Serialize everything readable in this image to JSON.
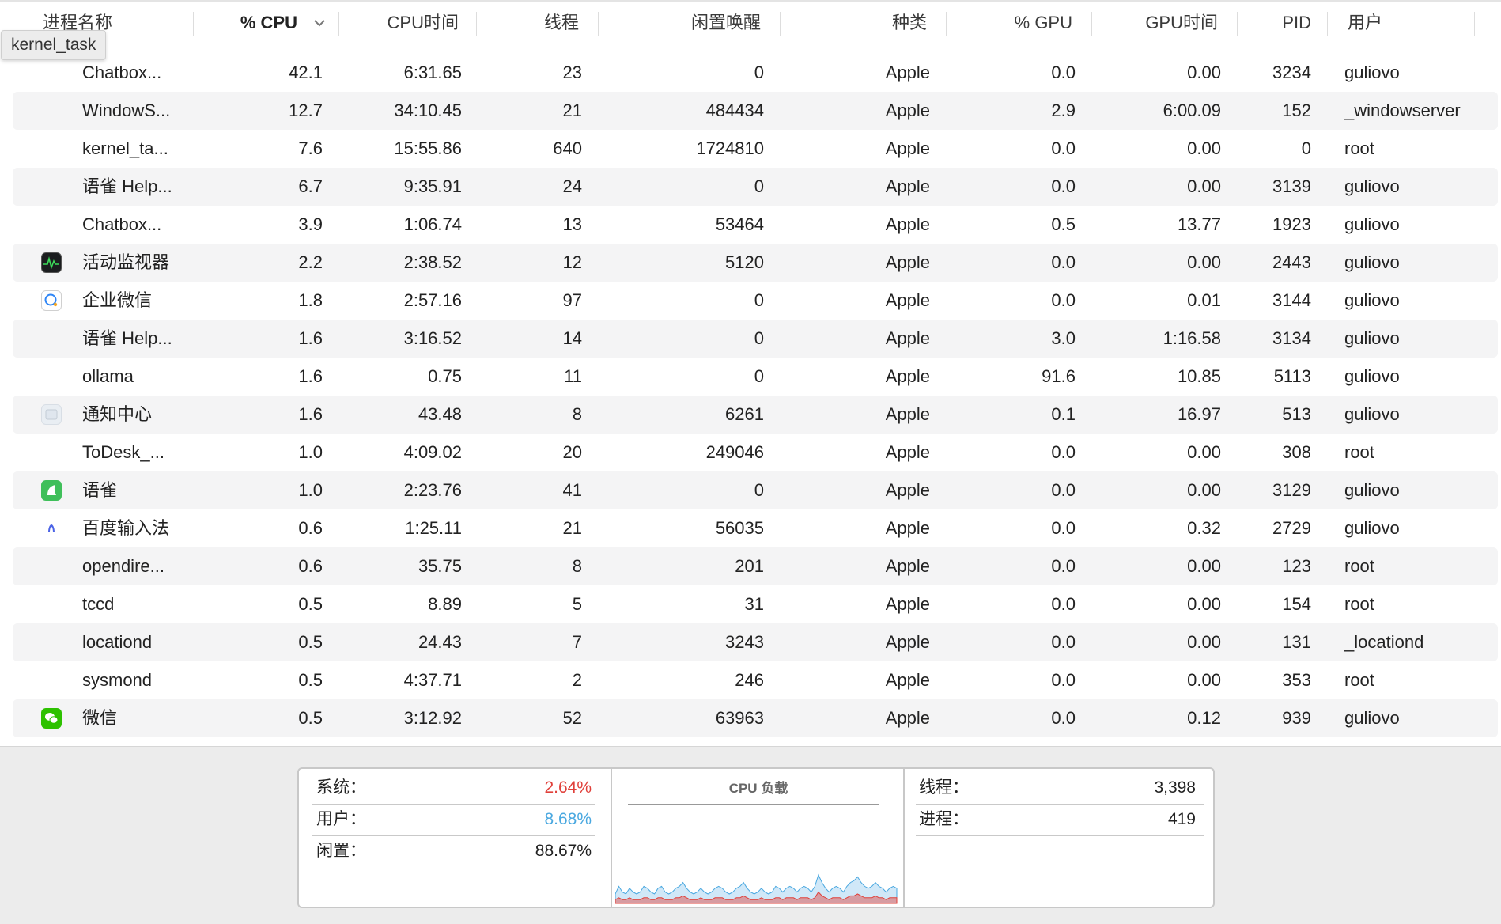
{
  "tooltip": "kernel_task",
  "headers": {
    "name": "进程名称",
    "cpu": "% CPU",
    "cpu_time": "CPU时间",
    "threads": "线程",
    "idle_wake": "闲置唤醒",
    "kind": "种类",
    "gpu": "% GPU",
    "gpu_time": "GPU时间",
    "pid": "PID",
    "user": "用户"
  },
  "sort_indicator": "chevron-down-icon",
  "processes": [
    {
      "icon": "",
      "name": "Chatbox...",
      "cpu": "42.1",
      "cpu_time": "6:31.65",
      "threads": "23",
      "idle_wake": "0",
      "kind": "Apple",
      "gpu": "0.0",
      "gpu_time": "0.00",
      "pid": "3234",
      "user": "guliovo"
    },
    {
      "icon": "",
      "name": "WindowS...",
      "cpu": "12.7",
      "cpu_time": "34:10.45",
      "threads": "21",
      "idle_wake": "484434",
      "kind": "Apple",
      "gpu": "2.9",
      "gpu_time": "6:00.09",
      "pid": "152",
      "user": "_windowserver"
    },
    {
      "icon": "",
      "name": "kernel_ta...",
      "cpu": "7.6",
      "cpu_time": "15:55.86",
      "threads": "640",
      "idle_wake": "1724810",
      "kind": "Apple",
      "gpu": "0.0",
      "gpu_time": "0.00",
      "pid": "0",
      "user": "root"
    },
    {
      "icon": "",
      "name": "语雀 Help...",
      "cpu": "6.7",
      "cpu_time": "9:35.91",
      "threads": "24",
      "idle_wake": "0",
      "kind": "Apple",
      "gpu": "0.0",
      "gpu_time": "0.00",
      "pid": "3139",
      "user": "guliovo"
    },
    {
      "icon": "",
      "name": "Chatbox...",
      "cpu": "3.9",
      "cpu_time": "1:06.74",
      "threads": "13",
      "idle_wake": "53464",
      "kind": "Apple",
      "gpu": "0.5",
      "gpu_time": "13.77",
      "pid": "1923",
      "user": "guliovo"
    },
    {
      "icon": "activity-monitor-icon",
      "name": "活动监视器",
      "cpu": "2.2",
      "cpu_time": "2:38.52",
      "threads": "12",
      "idle_wake": "5120",
      "kind": "Apple",
      "gpu": "0.0",
      "gpu_time": "0.00",
      "pid": "2443",
      "user": "guliovo"
    },
    {
      "icon": "wecom-icon",
      "name": "企业微信",
      "cpu": "1.8",
      "cpu_time": "2:57.16",
      "threads": "97",
      "idle_wake": "0",
      "kind": "Apple",
      "gpu": "0.0",
      "gpu_time": "0.01",
      "pid": "3144",
      "user": "guliovo"
    },
    {
      "icon": "",
      "name": "语雀 Help...",
      "cpu": "1.6",
      "cpu_time": "3:16.52",
      "threads": "14",
      "idle_wake": "0",
      "kind": "Apple",
      "gpu": "3.0",
      "gpu_time": "1:16.58",
      "pid": "3134",
      "user": "guliovo"
    },
    {
      "icon": "",
      "name": "ollama",
      "cpu": "1.6",
      "cpu_time": "0.75",
      "threads": "11",
      "idle_wake": "0",
      "kind": "Apple",
      "gpu": "91.6",
      "gpu_time": "10.85",
      "pid": "5113",
      "user": "guliovo"
    },
    {
      "icon": "notification-center-icon",
      "name": "通知中心",
      "cpu": "1.6",
      "cpu_time": "43.48",
      "threads": "8",
      "idle_wake": "6261",
      "kind": "Apple",
      "gpu": "0.1",
      "gpu_time": "16.97",
      "pid": "513",
      "user": "guliovo"
    },
    {
      "icon": "",
      "name": "ToDesk_...",
      "cpu": "1.0",
      "cpu_time": "4:09.02",
      "threads": "20",
      "idle_wake": "249046",
      "kind": "Apple",
      "gpu": "0.0",
      "gpu_time": "0.00",
      "pid": "308",
      "user": "root"
    },
    {
      "icon": "yuque-icon",
      "name": "语雀",
      "cpu": "1.0",
      "cpu_time": "2:23.76",
      "threads": "41",
      "idle_wake": "0",
      "kind": "Apple",
      "gpu": "0.0",
      "gpu_time": "0.00",
      "pid": "3129",
      "user": "guliovo"
    },
    {
      "icon": "baidu-input-icon",
      "name": "百度输入法",
      "cpu": "0.6",
      "cpu_time": "1:25.11",
      "threads": "21",
      "idle_wake": "56035",
      "kind": "Apple",
      "gpu": "0.0",
      "gpu_time": "0.32",
      "pid": "2729",
      "user": "guliovo"
    },
    {
      "icon": "",
      "name": "opendire...",
      "cpu": "0.6",
      "cpu_time": "35.75",
      "threads": "8",
      "idle_wake": "201",
      "kind": "Apple",
      "gpu": "0.0",
      "gpu_time": "0.00",
      "pid": "123",
      "user": "root"
    },
    {
      "icon": "",
      "name": "tccd",
      "cpu": "0.5",
      "cpu_time": "8.89",
      "threads": "5",
      "idle_wake": "31",
      "kind": "Apple",
      "gpu": "0.0",
      "gpu_time": "0.00",
      "pid": "154",
      "user": "root"
    },
    {
      "icon": "",
      "name": "locationd",
      "cpu": "0.5",
      "cpu_time": "24.43",
      "threads": "7",
      "idle_wake": "3243",
      "kind": "Apple",
      "gpu": "0.0",
      "gpu_time": "0.00",
      "pid": "131",
      "user": "_locationd"
    },
    {
      "icon": "",
      "name": "sysmond",
      "cpu": "0.5",
      "cpu_time": "4:37.71",
      "threads": "2",
      "idle_wake": "246",
      "kind": "Apple",
      "gpu": "0.0",
      "gpu_time": "0.00",
      "pid": "353",
      "user": "root"
    },
    {
      "icon": "wechat-icon",
      "name": "微信",
      "cpu": "0.5",
      "cpu_time": "3:12.92",
      "threads": "52",
      "idle_wake": "63963",
      "kind": "Apple",
      "gpu": "0.0",
      "gpu_time": "0.12",
      "pid": "939",
      "user": "guliovo"
    }
  ],
  "summary": {
    "system_label": "系统：",
    "system_value": "2.64%",
    "user_label": "用户：",
    "user_value": "8.68%",
    "idle_label": "闲置：",
    "idle_value": "88.67%",
    "chart_title": "CPU 负载",
    "threads_label": "线程：",
    "threads_value": "3,398",
    "processes_label": "进程：",
    "processes_value": "419"
  },
  "colors": {
    "system": "#e0403a",
    "user": "#4aa8e0",
    "row_alt": "#f4f4f5"
  },
  "cpu_load_history": {
    "user": [
      3,
      6,
      4,
      3,
      5,
      4,
      3,
      4,
      6,
      5,
      4,
      3,
      5,
      6,
      4,
      3,
      4,
      5,
      6,
      7,
      5,
      4,
      3,
      4,
      5,
      4,
      3,
      4,
      5,
      6,
      5,
      4,
      3,
      4,
      5,
      6,
      7,
      5,
      4,
      3,
      4,
      5,
      4,
      3,
      4,
      6,
      5,
      4,
      5,
      6,
      5,
      4,
      5,
      6,
      5,
      4,
      6,
      9,
      7,
      5,
      4,
      5,
      6,
      5,
      4,
      6,
      7,
      8,
      9,
      7,
      6,
      5,
      6,
      7,
      6,
      5,
      4,
      5,
      6,
      5
    ],
    "system": [
      2,
      3,
      2,
      2,
      3,
      2,
      2,
      2,
      3,
      3,
      2,
      2,
      3,
      3,
      2,
      2,
      2,
      3,
      3,
      4,
      3,
      2,
      2,
      2,
      3,
      2,
      2,
      2,
      3,
      3,
      3,
      2,
      2,
      2,
      3,
      3,
      4,
      3,
      2,
      2,
      2,
      3,
      2,
      2,
      2,
      3,
      3,
      2,
      3,
      3,
      3,
      2,
      3,
      3,
      3,
      2,
      3,
      6,
      4,
      3,
      2,
      3,
      3,
      3,
      2,
      3,
      4,
      4,
      5,
      4,
      3,
      3,
      3,
      4,
      3,
      3,
      2,
      3,
      3,
      3
    ]
  }
}
